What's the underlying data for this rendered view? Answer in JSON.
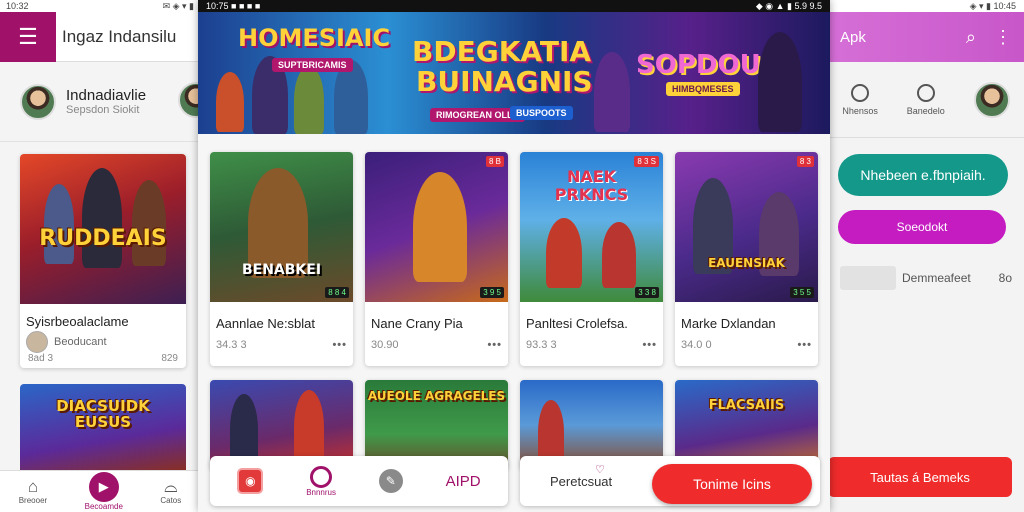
{
  "colors": {
    "brand": "#a0126a",
    "accent_red": "#ef2b2b",
    "teal": "#13988a",
    "magenta": "#c41cc1",
    "right_header": "#d66fd7"
  },
  "left": {
    "status_time": "10:32",
    "status_icons": "✉ ◈ ▾ ▮",
    "app_title": "Ingaz Indansilu",
    "profile": {
      "name": "Indnadiavlie",
      "subtitle": "Sepsdon Siokit"
    },
    "card": {
      "thumb_text": "RUDDEAIS",
      "title": "Syisrbeoalaclame",
      "developer": "Beoducant",
      "meta_left": "8ad 3",
      "meta_right": "829"
    },
    "card2_text": "DIACSUIDK EUSUS",
    "nav": [
      {
        "icon": "home-icon",
        "label": "Breooer"
      },
      {
        "icon": "play-icon",
        "label": "Becoamde"
      },
      {
        "icon": "bag-icon",
        "label": "Catos"
      }
    ]
  },
  "center": {
    "status_left": "10:75 ■ ■ ■ ■",
    "status_right": "◆ ◉ ▲ ▮ 5.9 9.5",
    "banner": {
      "title_left": "HOMESIAIC",
      "sub_left": "SUPTBRICAMIS",
      "title_mid_1": "BDEGKATIA",
      "title_mid_2": "BUINAGNIS",
      "sub_mid_1": "RIMOGREAN OLLS",
      "sub_mid_2": "BUSPOOTS",
      "title_right": "SOPDOUS",
      "sub_right": "HIMBQMESES"
    },
    "games": [
      {
        "thumb_text": "BENABKEI",
        "title": "Aannlae Ne:sblat",
        "size": "34.3 3",
        "badge": "8 8 4"
      },
      {
        "thumb_text": "",
        "title": "Nane Crany Pia",
        "size": "30.90",
        "badge": "3 9 5",
        "badge_top": "8 B"
      },
      {
        "thumb_text": "NAEK PRKNCS",
        "title": "Panltesi Crolefsa.",
        "size": "93.3 3",
        "badge": "3 3 8",
        "badge_top": "8 3 S"
      },
      {
        "thumb_text": "EAUENSIAK",
        "title": "Marke Dxlandan",
        "size": "34.0 0",
        "badge": "3 5 5",
        "badge_top": "8 3"
      }
    ],
    "row2": [
      {
        "thumb_text": ""
      },
      {
        "thumb_text": "AUEOLE AGRAGELES"
      },
      {
        "thumb_text": ""
      },
      {
        "thumb_text": "FLACSAIIS"
      }
    ],
    "actionbar": {
      "label_mid": "Bnnnrus",
      "label_right": "AIPD"
    },
    "actionbar2": {
      "label": "Peretcsuat"
    },
    "primary_button": "Tonime Icins"
  },
  "right": {
    "status_icons": "◈ ▾ ▮ 10:45",
    "header_title": "Apk",
    "tabs": [
      {
        "icon": "stats-icon",
        "label": "Nhensos"
      },
      {
        "icon": "settings-icon",
        "label": "Banedelo"
      }
    ],
    "teal_button": "Nhebeen e.fbnpiaih.",
    "pink_button": "Soeodokt",
    "info_label": "Demmeafeet",
    "info_value": "8o",
    "bottom_button": "Tautas á Bemeks"
  }
}
